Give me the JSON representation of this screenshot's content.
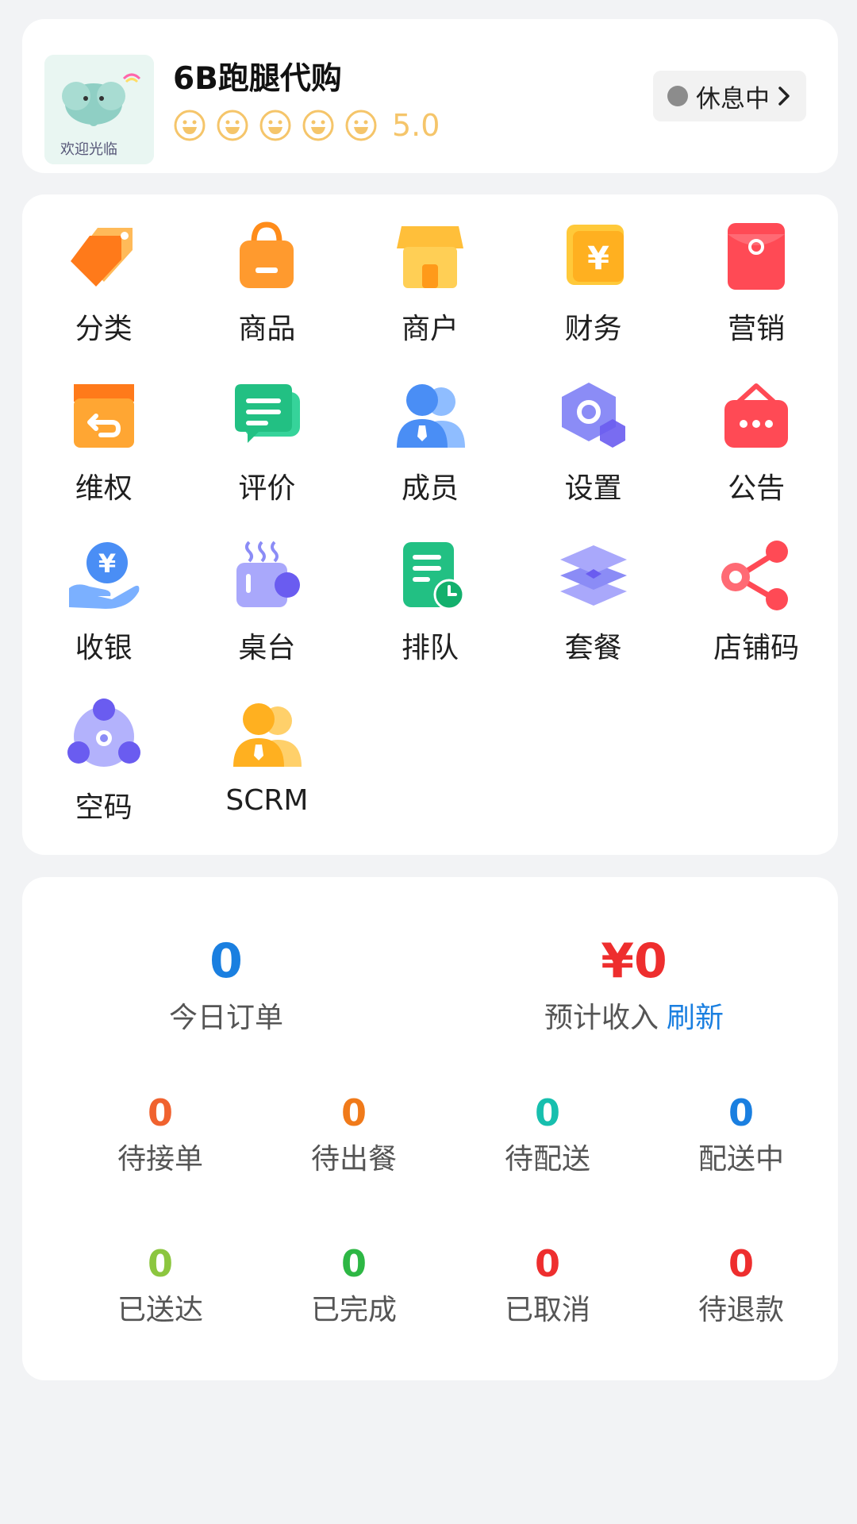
{
  "store": {
    "name": "6B跑腿代购",
    "avatar_text": "欢迎光临",
    "rating_value": "5.0",
    "stars": 5,
    "status_label": "休息中"
  },
  "menu": [
    {
      "label": "分类",
      "icon": "tag-icon"
    },
    {
      "label": "商品",
      "icon": "shopping-bag-icon"
    },
    {
      "label": "商户",
      "icon": "storefront-icon"
    },
    {
      "label": "财务",
      "icon": "yuan-card-icon"
    },
    {
      "label": "营销",
      "icon": "red-packet-icon"
    },
    {
      "label": "维权",
      "icon": "return-box-icon"
    },
    {
      "label": "评价",
      "icon": "comment-icon"
    },
    {
      "label": "成员",
      "icon": "members-icon"
    },
    {
      "label": "设置",
      "icon": "settings-hex-icon"
    },
    {
      "label": "公告",
      "icon": "notice-bag-icon"
    },
    {
      "label": "收银",
      "icon": "cashier-hand-icon"
    },
    {
      "label": "桌台",
      "icon": "cup-table-icon"
    },
    {
      "label": "排队",
      "icon": "queue-doc-icon"
    },
    {
      "label": "套餐",
      "icon": "layers-icon"
    },
    {
      "label": "店铺码",
      "icon": "share-icon"
    },
    {
      "label": "空码",
      "icon": "empty-code-icon"
    },
    {
      "label": "SCRM",
      "icon": "scrm-users-icon"
    }
  ],
  "stats": {
    "today_orders": {
      "value": "0",
      "label": "今日订单",
      "color": "#1a7fe0"
    },
    "expected_income": {
      "value": "¥0",
      "label": "预计收入",
      "refresh_label": "刷新",
      "color": "#ee2e2e"
    },
    "row1": [
      {
        "value": "0",
        "label": "待接单",
        "color": "#f0622f"
      },
      {
        "value": "0",
        "label": "待出餐",
        "color": "#f07a1a"
      },
      {
        "value": "0",
        "label": "待配送",
        "color": "#17bfae"
      },
      {
        "value": "0",
        "label": "配送中",
        "color": "#1a7fe0"
      }
    ],
    "row2": [
      {
        "value": "0",
        "label": "已送达",
        "color": "#8cc63f"
      },
      {
        "value": "0",
        "label": "已完成",
        "color": "#2db744"
      },
      {
        "value": "0",
        "label": "已取消",
        "color": "#ee2e2e"
      },
      {
        "value": "0",
        "label": "待退款",
        "color": "#ee2e2e"
      }
    ]
  }
}
